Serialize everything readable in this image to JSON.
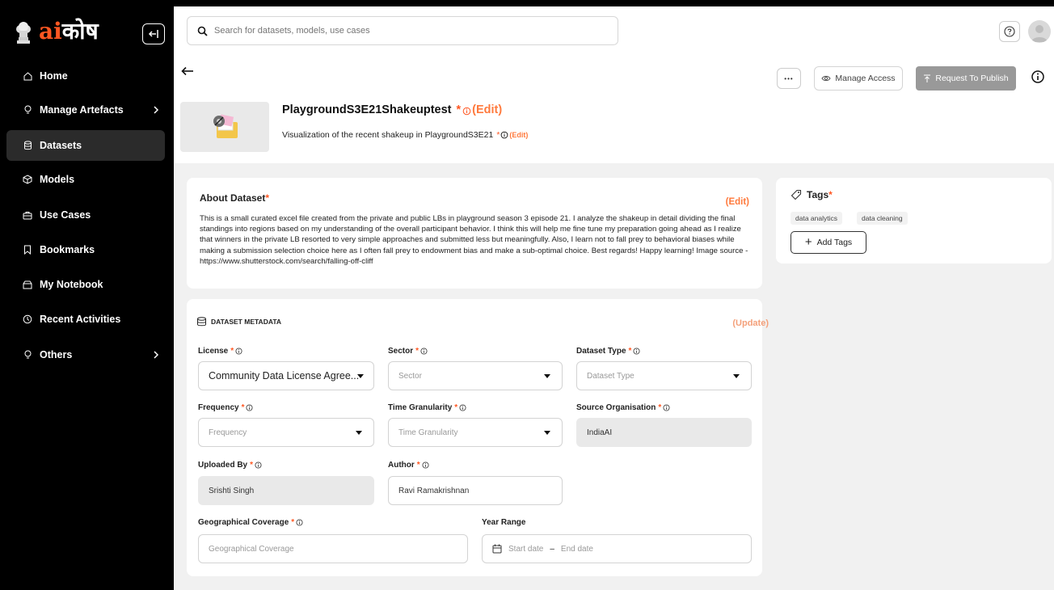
{
  "sidebar": {
    "logo": {
      "ai": "ai",
      "kosh": "कोष"
    },
    "items": [
      {
        "label": "Home",
        "icon": "home-icon"
      },
      {
        "label": "Manage Artefacts",
        "icon": "lightbulb-icon",
        "has_submenu": true
      },
      {
        "label": "Datasets",
        "icon": "database-icon",
        "active": true
      },
      {
        "label": "Models",
        "icon": "cube-icon"
      },
      {
        "label": "Use Cases",
        "icon": "briefcase-icon"
      },
      {
        "label": "Bookmarks",
        "icon": "bookmark-icon"
      },
      {
        "label": "My Notebook",
        "icon": "notebook-icon"
      },
      {
        "label": "Recent Activities",
        "icon": "clock-icon"
      },
      {
        "label": "Others",
        "icon": "lightbulb-icon",
        "has_submenu": true
      }
    ]
  },
  "search": {
    "placeholder": "Search for datasets, models, use cases"
  },
  "actions": {
    "more": "•••",
    "manage_access": "Manage Access",
    "request_publish": "Request To Publish"
  },
  "dataset": {
    "title": "PlaygroundS3E21Shakeuptest",
    "title_star": "*",
    "edit": "(Edit)",
    "subtitle": "Visualization of the recent shakeup in PlaygroundS3E21",
    "subtitle_star": "*"
  },
  "about": {
    "title": "About Dataset",
    "star": "*",
    "edit": "(Edit)",
    "body": "This is a small curated excel file created from the private and public LBs in playground season 3 episode 21. I analyze the shakeup in detail dividing the final standings into regions based on my understanding of the overall participant behavior. I think this will help me fine tune my preparation going ahead as I realize that winners in the private LB resorted to very simple approaches and submitted less but meaningfully. Also, I learn not to fall prey to behavioral biases while making a submission selection choice here as I often fall prey to endowment bias and make a sub-optimal choice. Best regards! Happy learning! Image source - https://www.shutterstock.com/search/falling-off-cliff"
  },
  "tags": {
    "title": "Tags",
    "star": "*",
    "items": [
      "data analytics",
      "data cleaning"
    ],
    "add_label": "Add Tags"
  },
  "metadata": {
    "title": "DATASET METADATA",
    "update": "(Update)",
    "star": "*",
    "fields": {
      "license": {
        "label": "License",
        "value": "Community Data License Agree..."
      },
      "sector": {
        "label": "Sector",
        "placeholder": "Sector"
      },
      "dataset_type": {
        "label": "Dataset Type",
        "placeholder": "Dataset Type"
      },
      "frequency": {
        "label": "Frequency",
        "placeholder": "Frequency"
      },
      "time_granularity": {
        "label": "Time Granularity",
        "placeholder": "Time Granularity"
      },
      "source_org": {
        "label": "Source Organisation",
        "value": "IndiaAI"
      },
      "uploaded_by": {
        "label": "Uploaded By",
        "value": "Srishti Singh"
      },
      "author": {
        "label": "Author",
        "value": "Ravi Ramakrishnan"
      },
      "geo_coverage": {
        "label": "Geographical Coverage",
        "placeholder": "Geographical Coverage"
      },
      "year_range": {
        "label": "Year Range",
        "start": "Start date",
        "sep": "–",
        "end": "End date"
      }
    }
  },
  "colors": {
    "accent": "#ff5722",
    "edit": "#ff7a3d",
    "sidebar_bg": "#000000"
  }
}
